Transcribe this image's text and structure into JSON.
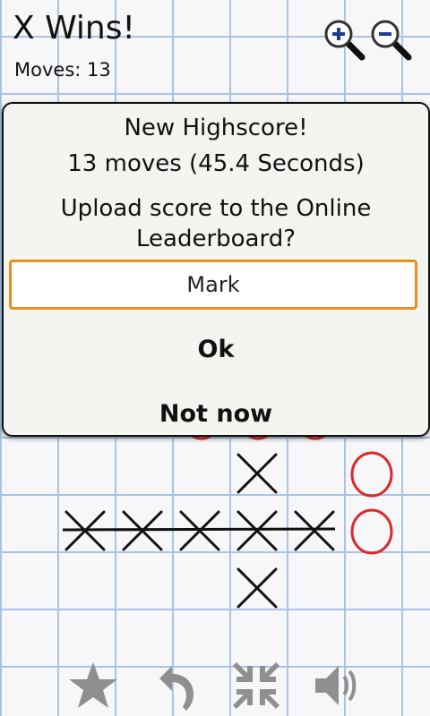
{
  "header": {
    "title": "X Wins!",
    "moves": "Moves: 13"
  },
  "zoom": {
    "in_icon": "zoom-in-icon",
    "out_icon": "zoom-out-icon"
  },
  "dialog": {
    "title": "New Highscore!",
    "score": "13 moves (45.4 Seconds)",
    "question_line1": "Upload score to the Online",
    "question_line2": "Leaderboard?",
    "name_value": "Mark",
    "ok_label": "Ok",
    "not_now_label": "Not now"
  },
  "toolbar": {
    "icons": [
      "star-icon",
      "undo-icon",
      "shrink-icon",
      "speaker-icon"
    ]
  },
  "colors": {
    "grid": "#a9c3e6",
    "x_mark": "#111111",
    "o_mark": "#d92b2b",
    "input_border": "#e8901d"
  }
}
